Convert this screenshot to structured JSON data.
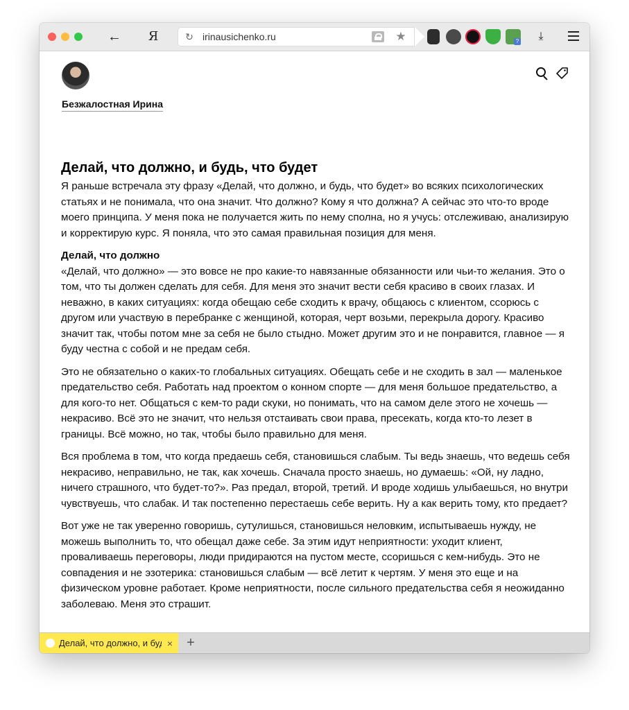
{
  "browser": {
    "url": "irinausichenko.ru",
    "ya_logo": "Я",
    "tab_title": "Делай, что должно, и будь, что будет",
    "ext_badge": "?"
  },
  "site": {
    "name": "Безжалостная Ирина"
  },
  "article": {
    "title": "Делай, что должно, и будь, что будет",
    "intro": "Я раньше встречала эту фразу «Делай, что должно, и будь, что будет» во всяких психологических статьях и не понимала, что она значит. Что должно? Кому я что должна? А сейчас это что-то вроде моего принципа. У меня пока не получается жить по нему сполна, но я учусь: отслеживаю, анализирую и корректирую курс. Я поняла, что это самая правильная позиция для меня.",
    "subheading": "Делай, что должно",
    "p1": "«Делай, что должно» — это вовсе не про какие-то навязанные обязанности или чьи-то желания. Это о том, что ты должен сделать для себя. Для меня это значит вести себя красиво в своих глазах. И неважно, в каких ситуациях: когда обещаю себе сходить к врачу, общаюсь с клиентом, ссорюсь с другом или участвую в перебранке с женщиной, которая, черт возьми, перекрыла дорогу. Красиво значит так, чтобы потом мне за себя не было стыдно. Может другим это и не понравится, главное — я буду честна с собой и не предам себя.",
    "p2": "Это не обязательно о каких-то глобальных ситуациях. Обещать себе и не сходить в зал — маленькое предательство себя. Работать над проектом о конном спорте  — для меня большое предательство, а для кого-то нет. Общаться с кем-то ради скуки, но понимать, что на самом деле этого не хочешь — некрасиво. Всё это не значит, что нельзя отстаивать свои права, пресекать, когда кто-то лезет в границы. Всё можно, но так, чтобы было правильно для меня.",
    "p3": "Вся проблема в том, что когда предаешь себя, становишься слабым. Ты ведь знаешь, что ведешь себя некрасиво, неправильно, не так, как хочешь. Сначала просто знаешь, но думаешь: «Ой, ну ладно, ничего страшного, что будет-то?». Раз предал, второй, третий. И вроде ходишь улыбаешься, но внутри чувствуешь, что слабак. И так постепенно перестаешь себе верить. Ну а как верить тому, кто предает?",
    "p4": "Вот уже не так уверенно говоришь, сутулишься, становишься неловким, испытываешь нужду, не можешь выполнить то, что обещал даже себе. За этим идут неприятности: уходит клиент, проваливаешь переговоры, люди придираются на пустом месте, ссоришься с кем-нибудь. Это не совпадения и не эзотерика: становишься слабым — всё летит к чертям. У меня это еще и на физическом уровне работает. Кроме неприятности, после сильного предательства себя я неожиданно заболеваю. Меня это страшит."
  },
  "icons": {
    "back": "←",
    "reload": "↻",
    "star": "★",
    "download": "⤓",
    "tag": "⌂",
    "close": "×",
    "plus": "+"
  }
}
